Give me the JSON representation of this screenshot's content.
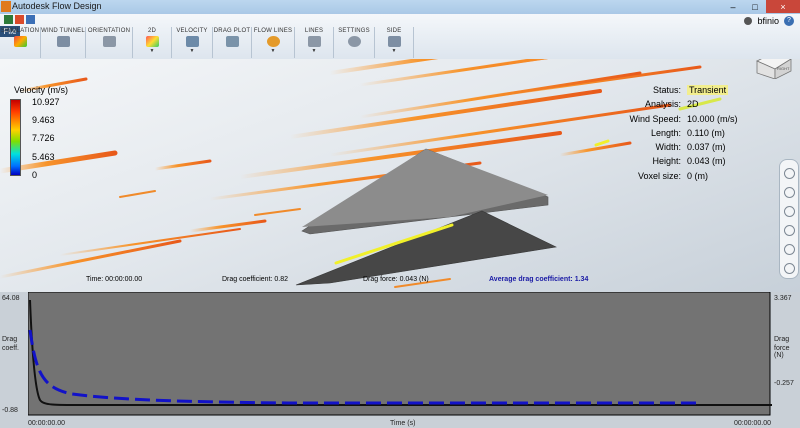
{
  "window": {
    "title": "Autodesk Flow Design",
    "close_glyph": "×"
  },
  "ribbon": {
    "file_label": "File",
    "user": "bfinio",
    "help": "?",
    "groups": [
      {
        "label": "SIMULATION"
      },
      {
        "label": "WIND TUNNEL"
      },
      {
        "label": "ORIENTATION"
      },
      {
        "label": "2D"
      },
      {
        "label": "VELOCITY"
      },
      {
        "label": "DRAG PLOT"
      },
      {
        "label": "FLOW LINES"
      },
      {
        "label": "LINES"
      },
      {
        "label": "SETTINGS"
      },
      {
        "label": "SIDE"
      }
    ]
  },
  "legend": {
    "title": "Velocity (m/s)",
    "ticks": [
      "10.927",
      "9.463",
      "7.726",
      "5.463",
      "0"
    ]
  },
  "status": {
    "rows": [
      {
        "label": "Status:",
        "value": "Transient"
      },
      {
        "label": "Analysis:",
        "value": "2D"
      },
      {
        "label": "Wind Speed:",
        "value": "10.000 (m/s)"
      },
      {
        "label": "Length:",
        "value": "0.110 (m)"
      },
      {
        "label": "Width:",
        "value": "0.037 (m)"
      },
      {
        "label": "Height:",
        "value": "0.043 (m)"
      },
      {
        "label": "Voxel size:",
        "value": "0 (m)"
      }
    ]
  },
  "viewcube": {
    "face_label": "RIGHT"
  },
  "info": {
    "time": "Time: 00:00:00.00",
    "drag_coef": "Drag coefficient: 0.82",
    "drag_force": "Drag force: 0.043 (N)",
    "avg_drag": "Average drag coefficient: 1.34"
  },
  "plot": {
    "left_top": "64.08",
    "left_bottom": "-0.88",
    "left_title_1": "Drag",
    "left_title_2": "coeff.",
    "right_top": "3.367",
    "right_bottom": "-0.257",
    "right_title_1": "Drag",
    "right_title_2": "force (N)",
    "x_label": "Time (s)",
    "x_start": "00:00:00.00",
    "x_end": "00:00:00.00"
  },
  "colors": {
    "accent": "#1a1aa5",
    "status_highlight": "#f2ee8e"
  }
}
